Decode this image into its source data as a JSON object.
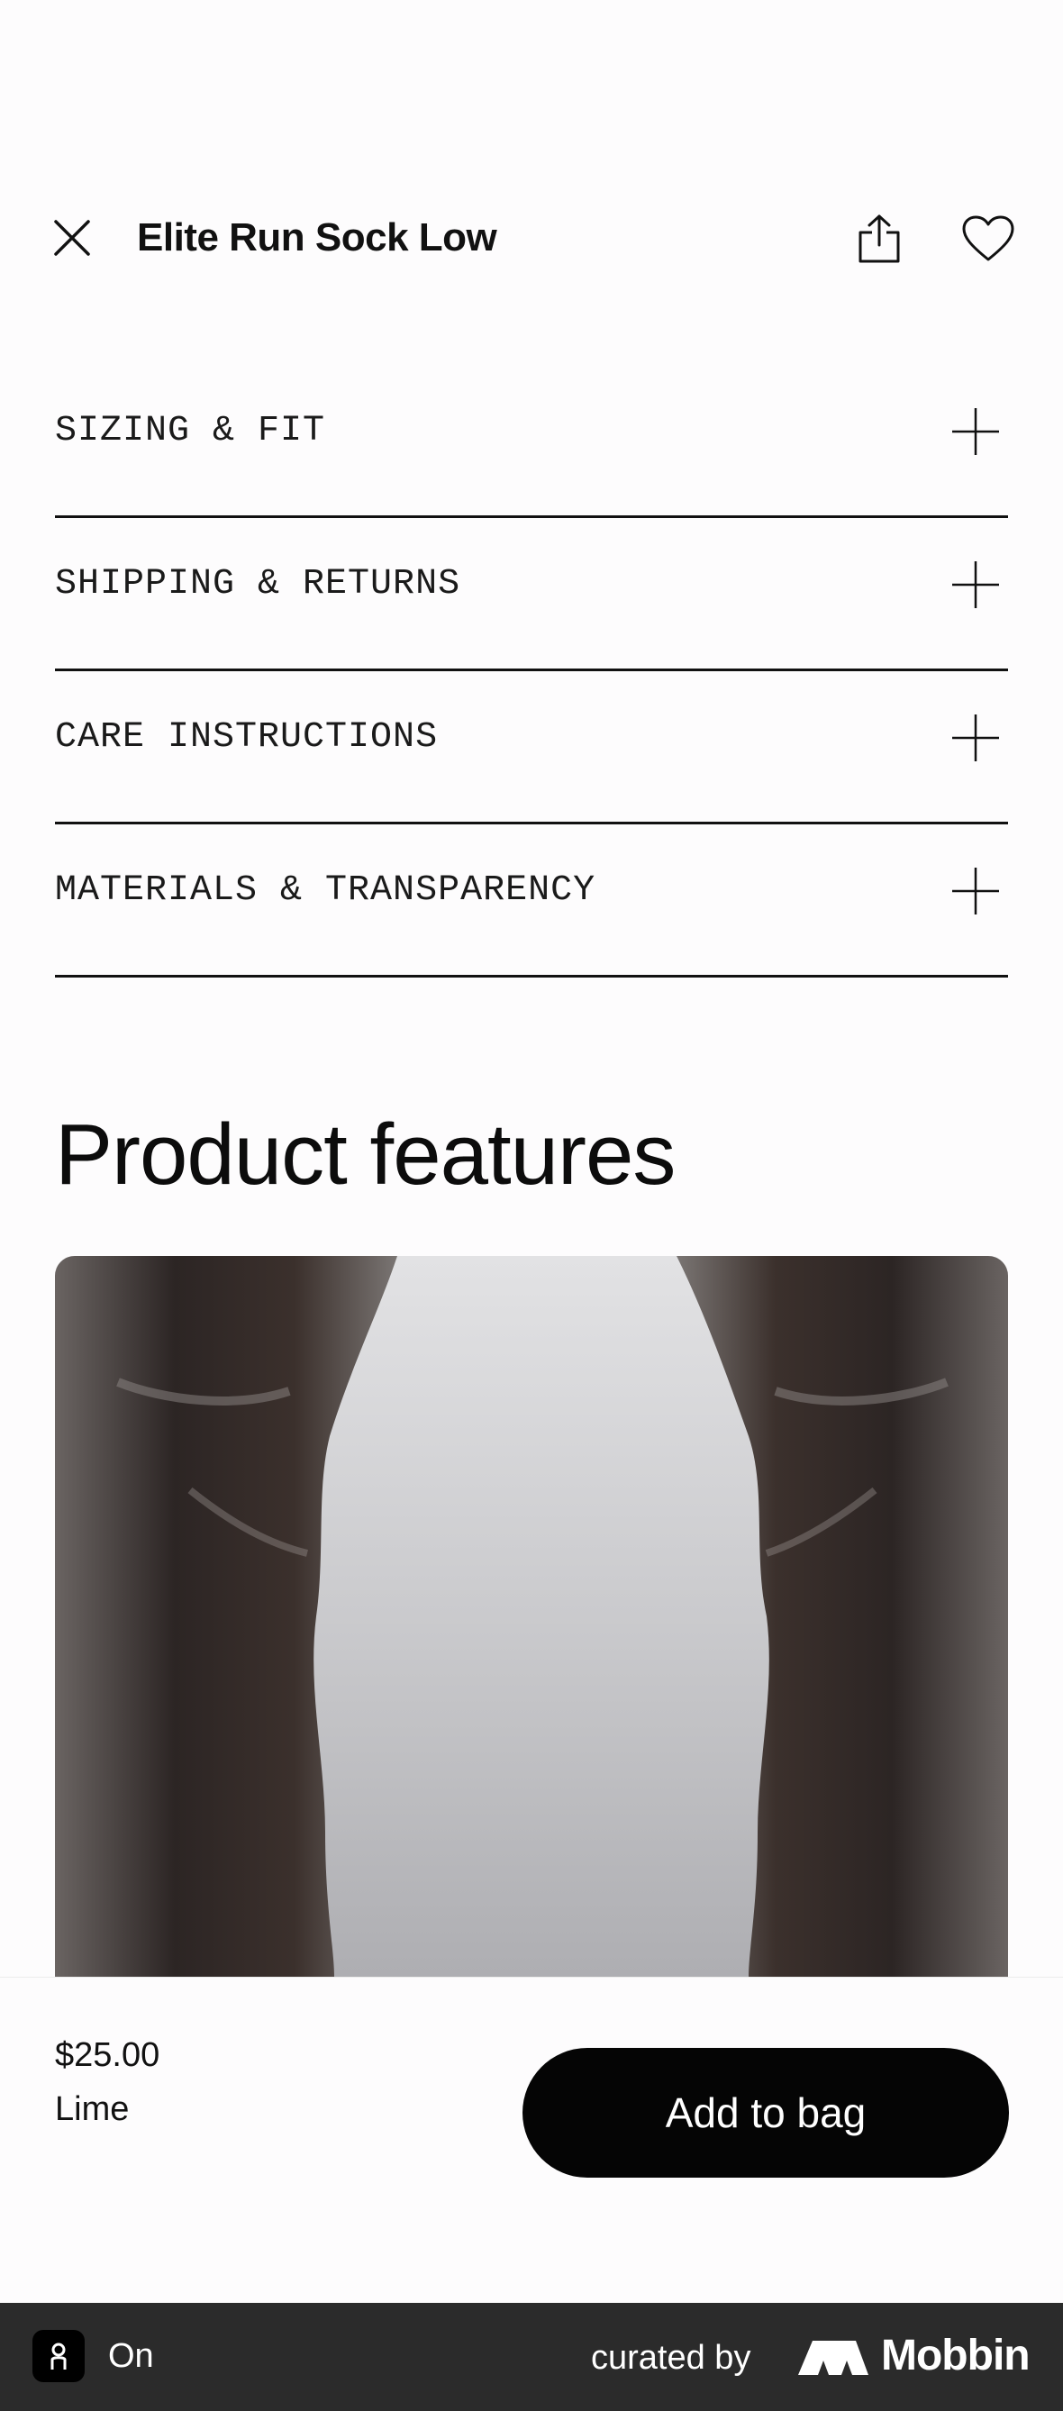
{
  "header": {
    "title": "Elite Run Sock Low",
    "close_icon": "close-icon",
    "share_icon": "share-icon",
    "favorite_icon": "heart-icon"
  },
  "accordion": {
    "items": [
      {
        "label": "SIZING & FIT"
      },
      {
        "label": "SHIPPING & RETURNS"
      },
      {
        "label": "CARE INSTRUCTIONS"
      },
      {
        "label": "MATERIALS & TRANSPARENCY"
      }
    ],
    "expand_icon": "plus-icon"
  },
  "features": {
    "title": "Product features"
  },
  "purchase": {
    "price": "$25.00",
    "color": "Lime",
    "add_label": "Add to bag"
  },
  "footer": {
    "brand": "On",
    "curated": "curated by",
    "provider": "Mobbin"
  },
  "colors": {
    "background": "#fdfcfd",
    "button": "#050505",
    "footer": "#2b2b2b"
  }
}
